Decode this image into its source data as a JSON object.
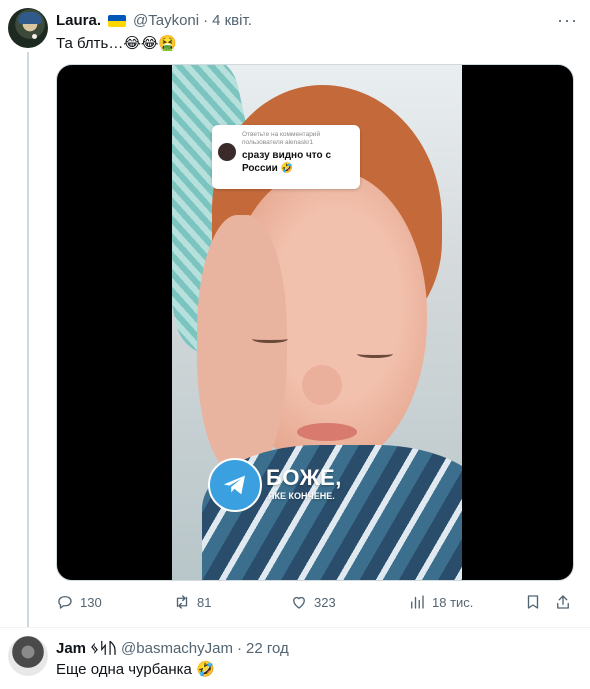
{
  "tweet1": {
    "name": "Laura.",
    "handle": "@Taykoni",
    "separator": "·",
    "time": "4 квіт.",
    "text": "Та блть…😂😂🤮",
    "media": {
      "comment_label": "Ответьте на комментарий пользователя alenaskr1",
      "comment_text": "сразу видно что с России 🤣",
      "watermark_title": "БОЖЕ,",
      "watermark_subtitle": "ЯКЕ КОНЧЕНЕ."
    },
    "actions": {
      "replies": "130",
      "reposts": "81",
      "likes": "323",
      "views": "18 тис."
    }
  },
  "tweet2": {
    "name": "Jam",
    "name_suffix": "ᛃᛋᚢ",
    "handle": "@basmachyJam",
    "separator": "·",
    "time": "22 год",
    "text": "Еще одна чурбанка 🤣"
  },
  "icons": [
    "more-icon",
    "ukraine-flag-icon",
    "reply-icon",
    "repost-icon",
    "like-icon",
    "views-icon",
    "bookmark-icon",
    "share-icon",
    "telegram-icon"
  ]
}
